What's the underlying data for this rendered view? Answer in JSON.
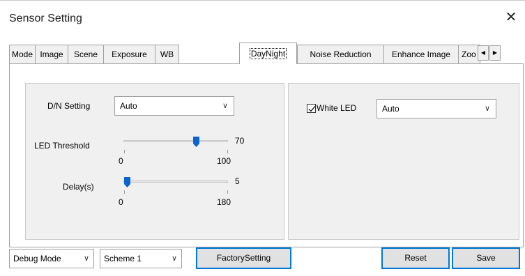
{
  "window": {
    "title": "Sensor Setting",
    "close_glyph": "✕"
  },
  "tabs": [
    {
      "label": "Mode"
    },
    {
      "label": "Image"
    },
    {
      "label": "Scene"
    },
    {
      "label": "Exposure"
    },
    {
      "label": "WB"
    },
    {
      "label": "DayNight"
    },
    {
      "label": "Noise Reduction"
    },
    {
      "label": "Enhance Image"
    },
    {
      "label": "Zoo"
    }
  ],
  "active_tab": "DayNight",
  "tab_scroll": {
    "left_glyph": "◀",
    "right_glyph": "▶"
  },
  "left_group": {
    "dn_setting": {
      "label": "D/N Setting",
      "value": "Auto"
    },
    "led_threshold": {
      "label": "LED Threshold",
      "value": "70",
      "min": "0",
      "max": "100",
      "level": 0.7
    },
    "delay": {
      "label": "Delay(s)",
      "value": "5",
      "min": "0",
      "max": "180",
      "level": 0.028
    }
  },
  "right_group": {
    "white_led": {
      "label": "White LED",
      "checked": true,
      "value": "Auto"
    }
  },
  "bottom": {
    "debug_mode": "Debug Mode",
    "scheme": "Scheme 1",
    "factory": "FactorySetting",
    "reset": "Reset",
    "save": "Save"
  },
  "colors": {
    "accent": "#0078d7",
    "slider_thumb": "#0a64d2",
    "group_bg": "#f0f0f0"
  }
}
